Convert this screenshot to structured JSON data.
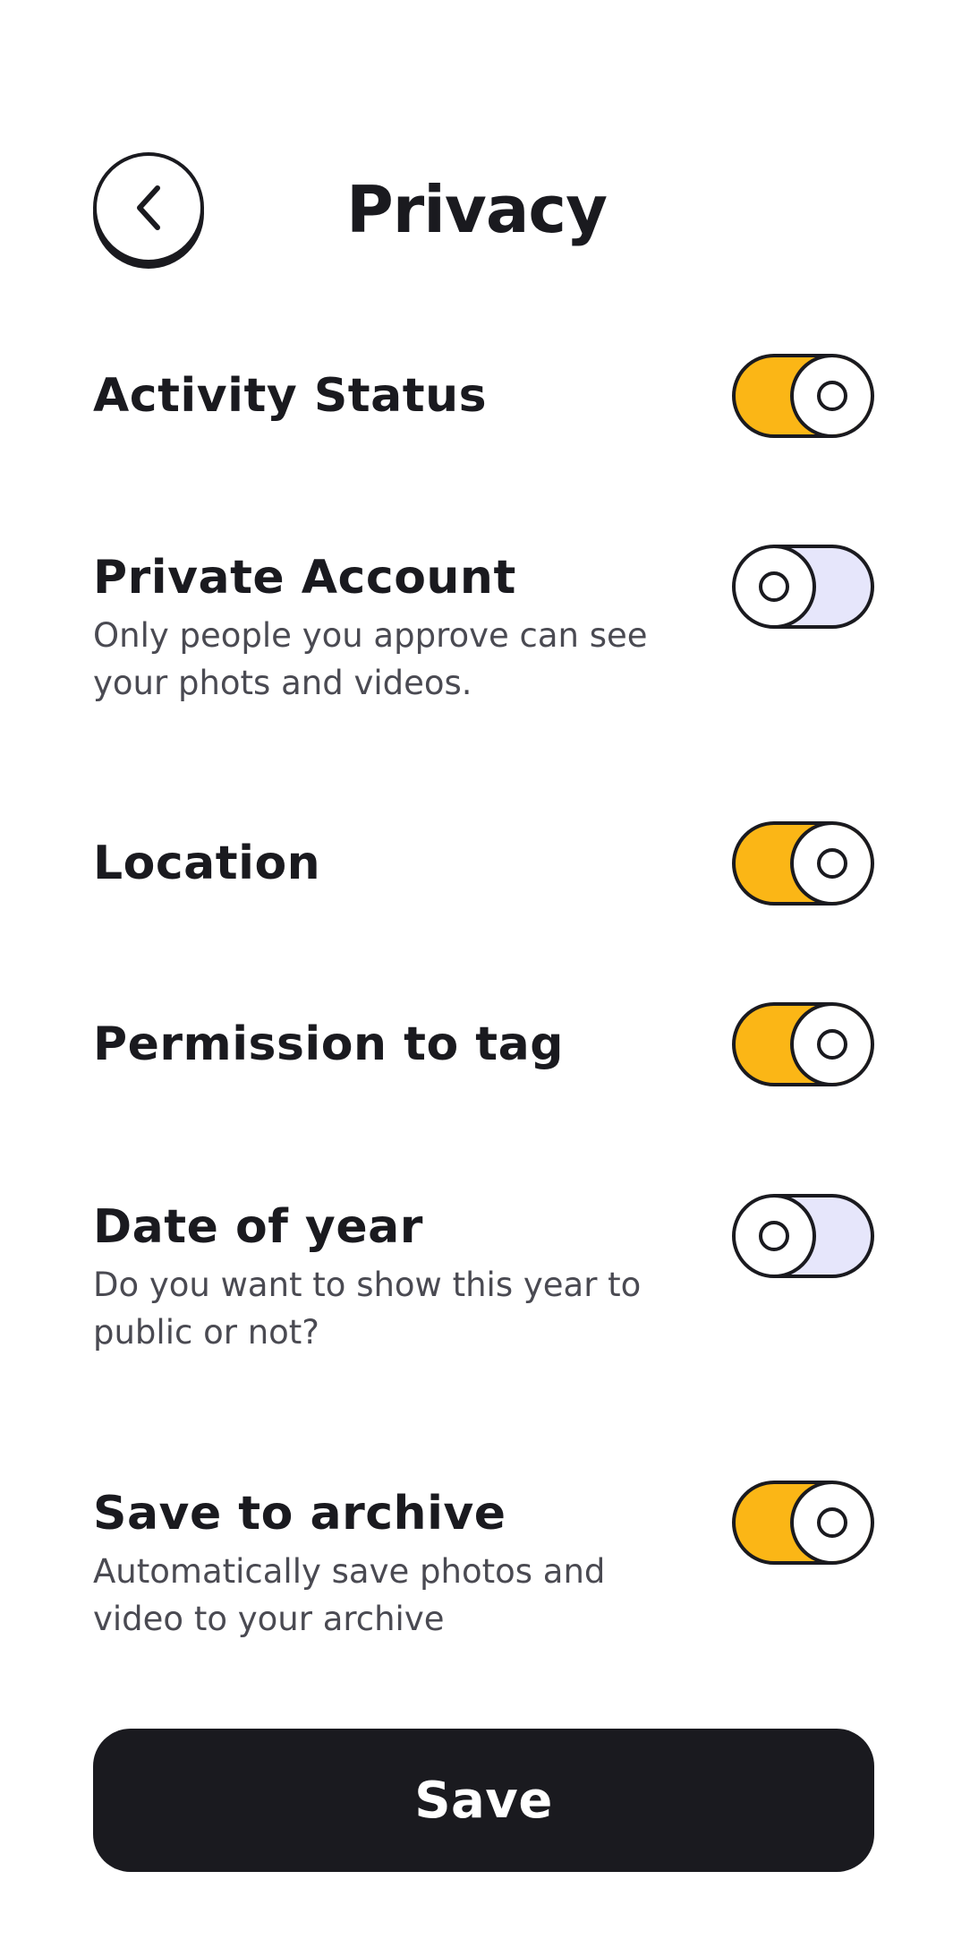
{
  "header": {
    "title": "Privacy",
    "back_icon": "chevron-left-icon"
  },
  "settings": [
    {
      "id": "activity-status",
      "title": "Activity Status",
      "description": "",
      "enabled": true
    },
    {
      "id": "private-account",
      "title": "Private Account",
      "description": "Only people you approve can see your phots and videos.",
      "enabled": false
    },
    {
      "id": "location",
      "title": "Location",
      "description": "",
      "enabled": true
    },
    {
      "id": "permission-to-tag",
      "title": "Permission to tag",
      "description": "",
      "enabled": true
    },
    {
      "id": "date-of-year",
      "title": "Date of year",
      "description": "Do you want to show this year to public or not?",
      "enabled": false
    },
    {
      "id": "save-to-archive",
      "title": "Save to archive",
      "description": "Automatically save photos and video to your archive",
      "enabled": true
    }
  ],
  "footer": {
    "save_label": "Save"
  },
  "colors": {
    "toggle_on": "#fbb616",
    "toggle_off": "#e6e6fb",
    "ink": "#1a1a1f",
    "description_text": "#4a4a52"
  }
}
